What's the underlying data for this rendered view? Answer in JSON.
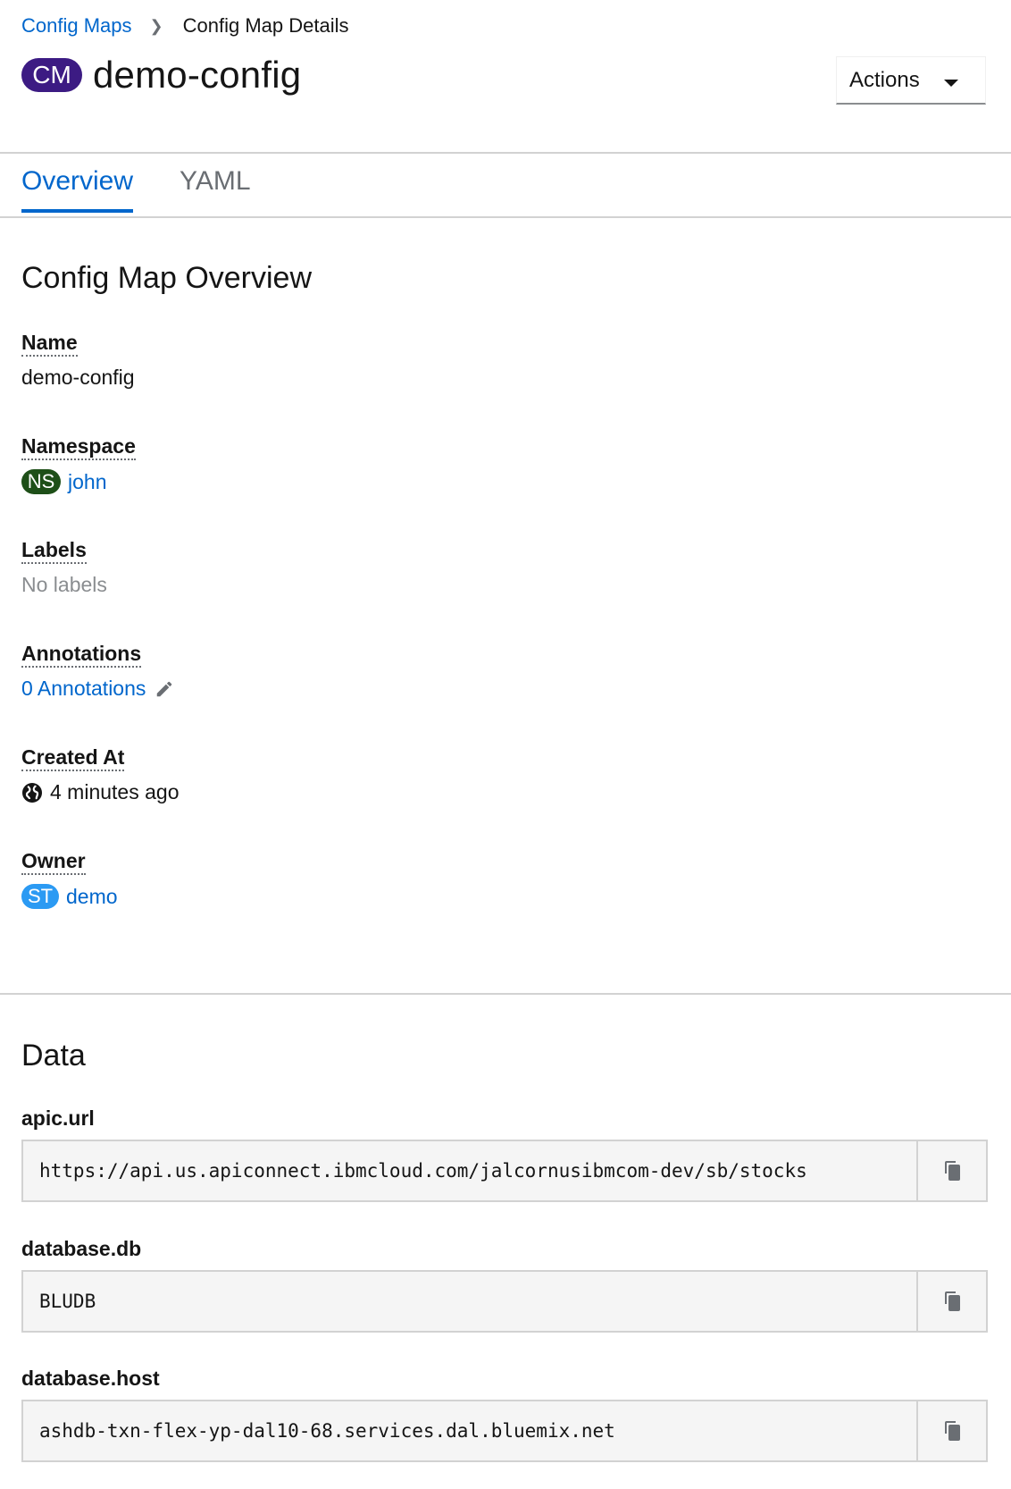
{
  "breadcrumb": {
    "parent": "Config Maps",
    "current": "Config Map Details"
  },
  "header": {
    "badge": "CM",
    "title": "demo-config",
    "actions_label": "Actions"
  },
  "tabs": [
    {
      "label": "Overview",
      "active": true
    },
    {
      "label": "YAML",
      "active": false
    }
  ],
  "overview": {
    "title": "Config Map Overview",
    "name_label": "Name",
    "name_value": "demo-config",
    "namespace_label": "Namespace",
    "namespace_badge": "NS",
    "namespace_value": "john",
    "labels_label": "Labels",
    "labels_value": "No labels",
    "annotations_label": "Annotations",
    "annotations_value": "0 Annotations",
    "created_label": "Created At",
    "created_value": "4 minutes ago",
    "owner_label": "Owner",
    "owner_badge": "ST",
    "owner_value": "demo"
  },
  "data_section": {
    "title": "Data",
    "items": [
      {
        "key": "apic.url",
        "value": "https://api.us.apiconnect.ibmcloud.com/jalcornusibmcom-dev/sb/stocks"
      },
      {
        "key": "database.db",
        "value": "BLUDB"
      },
      {
        "key": "database.host",
        "value": "ashdb-txn-flex-yp-dal10-68.services.dal.bluemix.net"
      }
    ]
  },
  "colors": {
    "link": "#0066cc",
    "cm_badge": "#3c1b83",
    "ns_badge": "#1e4f18",
    "st_badge": "#2b9af3"
  }
}
